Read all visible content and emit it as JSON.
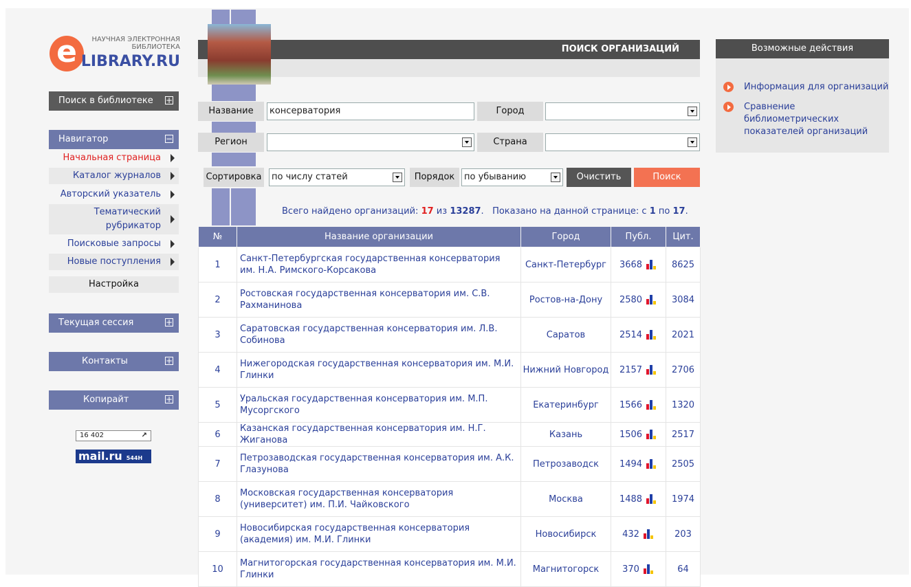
{
  "logo": {
    "letter": "e",
    "line1": "НАУЧНАЯ ЭЛЕКТРОННАЯ",
    "line2": "БИБЛИОТЕКА",
    "brand": "LIBRARY.RU",
    "brand_color": "#3a4fa3",
    "accent": "#f36b40"
  },
  "sidebar": {
    "search_library": "Поиск в библиотеке",
    "navigator": "Навигатор",
    "nav_items": [
      "Начальная страница",
      "Каталог журналов",
      "Авторский указатель",
      "Тематический рубрикатор",
      "Поисковые запросы",
      "Новые поступления"
    ],
    "settings": "Настройка",
    "current_session": "Текущая сессия",
    "contacts": "Контакты",
    "copyright": "Копирайт",
    "counter": "16 402",
    "mailru": "mail.ru",
    "mailru_count": "544H"
  },
  "header": {
    "title": "ПОИСК ОРГАНИЗАЦИЙ"
  },
  "form": {
    "name_label": "Название",
    "name_value": "консерватория",
    "city_label": "Город",
    "city_value": "",
    "region_label": "Регион",
    "region_value": "",
    "country_label": "Страна",
    "country_value": "",
    "sort_label": "Сортировка",
    "sort_value": "по числу статей",
    "order_label": "Порядок",
    "order_value": "по убыванию",
    "clear_button": "Очистить",
    "search_button": "Поиск"
  },
  "summary": {
    "prefix": "Всего найдено организаций:",
    "found": "17",
    "of": "из",
    "total": "13287",
    "shown_prefix": "Показано на данной странице: с",
    "from": "1",
    "to_word": "по",
    "to": "17"
  },
  "table": {
    "headers": [
      "№",
      "Название организации",
      "Город",
      "Публ.",
      "Цит."
    ],
    "rows": [
      {
        "n": "1",
        "name": "Санкт-Петербургская государственная консерватория им. Н.А. Римского-Корсакова",
        "city": "Санкт-Петербург",
        "pub": "3668",
        "cit": "8625"
      },
      {
        "n": "2",
        "name": "Ростовская государственная консерватория им. С.В. Рахманинова",
        "city": "Ростов-на-Дону",
        "pub": "2580",
        "cit": "3084"
      },
      {
        "n": "3",
        "name": "Саратовская государственная консерватория им. Л.В. Собинова",
        "city": "Саратов",
        "pub": "2514",
        "cit": "2021"
      },
      {
        "n": "4",
        "name": "Нижегородская государственная консерватория им. М.И. Глинки",
        "city": "Нижний Новгород",
        "pub": "2157",
        "cit": "2706"
      },
      {
        "n": "5",
        "name": "Уральская государственная консерватория им. М.П. Мусоргского",
        "city": "Екатеринбург",
        "pub": "1566",
        "cit": "1320"
      },
      {
        "n": "6",
        "name": "Казанская государственная консерватория им. Н.Г. Жиганова",
        "city": "Казань",
        "pub": "1506",
        "cit": "2517"
      },
      {
        "n": "7",
        "name": "Петрозаводская государственная консерватория им. А.К. Глазунова",
        "city": "Петрозаводск",
        "pub": "1494",
        "cit": "2505"
      },
      {
        "n": "8",
        "name": "Московская государственная консерватория (университет) им. П.И. Чайковского",
        "city": "Москва",
        "pub": "1488",
        "cit": "1974"
      },
      {
        "n": "9",
        "name": "Новосибирская государственная консерватория (академия) им. М.И. Глинки",
        "city": "Новосибирск",
        "pub": "432",
        "cit": "203"
      },
      {
        "n": "10",
        "name": "Магнитогорская государственная консерватория им. М.И. Глинки",
        "city": "Магнитогорск",
        "pub": "370",
        "cit": "64"
      }
    ]
  },
  "right_panel": {
    "title": "Возможные действия",
    "items": [
      "Информация для организаций",
      "Сравнение библиометрических показателей организаций"
    ]
  }
}
